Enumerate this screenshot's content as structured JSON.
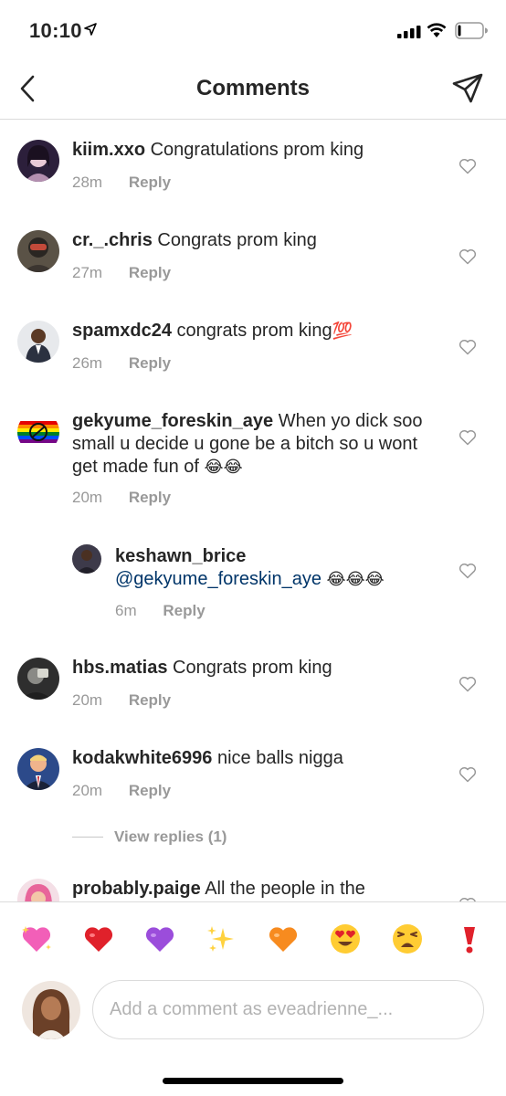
{
  "status_bar": {
    "time": "10:10",
    "icons": [
      "location-arrow-icon",
      "cellular-signal-icon",
      "wifi-icon",
      "battery-icon"
    ]
  },
  "header": {
    "title": "Comments",
    "back_icon": "chevron-left-icon",
    "send_icon": "paper-plane-icon"
  },
  "comments": [
    {
      "username": "kiim.xxo",
      "text": "Congratulations prom king",
      "time": "28m",
      "reply_label": "Reply"
    },
    {
      "username": "cr._.chris",
      "text": "Congrats prom king",
      "time": "27m",
      "reply_label": "Reply"
    },
    {
      "username": "spamxdc24",
      "text": "congrats prom king",
      "emoji": "💯",
      "time": "26m",
      "reply_label": "Reply"
    },
    {
      "username": "gekyume_foreskin_aye",
      "text": "When yo dick soo small u decide u gone be a bitch so u wont get made fun of",
      "emoji": "😂😂",
      "time": "20m",
      "reply_label": "Reply"
    },
    {
      "username": "keshawn_brice",
      "mention": "@gekyume_foreskin_aye",
      "emoji": "😂😂😂",
      "time": "6m",
      "reply_label": "Reply",
      "is_reply": true
    },
    {
      "username": "hbs.matias",
      "text": "Congrats prom king",
      "time": "20m",
      "reply_label": "Reply"
    },
    {
      "username": "kodakwhite6996",
      "text": "nice balls nigga",
      "time": "20m",
      "reply_label": "Reply"
    },
    {
      "username": "probably.paige",
      "text": "All the people in the"
    }
  ],
  "view_replies_label": "View replies (1)",
  "emoji_bar": [
    "💖",
    "❤️",
    "💜",
    "✨",
    "🧡",
    "😍",
    "😩",
    "❗"
  ],
  "composer": {
    "placeholder": "Add a comment as eveadrienne_..."
  },
  "colors": {
    "text": "#262626",
    "secondary": "#999999",
    "mention": "#003569",
    "divider": "#dbdbdb"
  }
}
